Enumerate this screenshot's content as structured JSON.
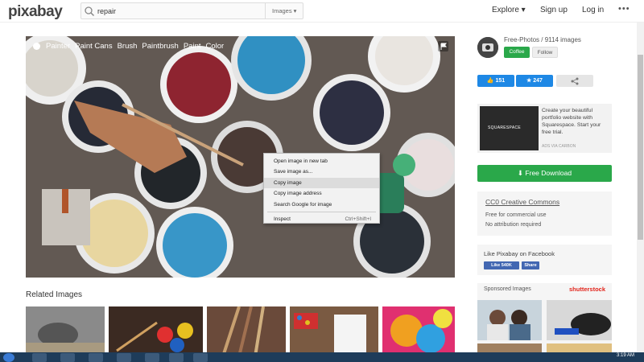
{
  "header": {
    "logo": "pixabay",
    "search_value": "repair",
    "search_type": "Images ▾",
    "nav": [
      "Explore ▾",
      "Sign up",
      "Log in"
    ],
    "more": "•••"
  },
  "photo": {
    "tags": [
      "Painter",
      "Paint Cans",
      "Brush",
      "Paintbrush",
      "Paint",
      "Color"
    ]
  },
  "context_menu": {
    "items": [
      {
        "label": "Open image in new tab",
        "shortcut": ""
      },
      {
        "label": "Save image as...",
        "shortcut": ""
      },
      {
        "label": "Copy image",
        "shortcut": ""
      },
      {
        "label": "Copy image address",
        "shortcut": ""
      },
      {
        "label": "Search Google for image",
        "shortcut": ""
      },
      {
        "label": "Inspect",
        "shortcut": "Ctrl+Shift+I"
      }
    ]
  },
  "related": {
    "title": "Related Images"
  },
  "sidebar": {
    "user_stats": "Free-Photos / 9114 images",
    "coffee_label": "Coffee",
    "follow_label": "Follow",
    "likes": "151",
    "favorites": "247",
    "ad": {
      "brand": "SQUARESPACE",
      "text": "Create your beautiful portfolio website with Squarespace. Start your free trial.",
      "via": "ADS VIA CARBON"
    },
    "download_label": "Free Download",
    "license": {
      "title": "CC0 Creative Commons",
      "lines": [
        "Free for commercial use",
        "No attribution required"
      ]
    },
    "facebook": {
      "title": "Like Pixabay on Facebook",
      "like_label": "Like 540K",
      "share_label": "Share"
    },
    "sponsored": {
      "title": "Sponsored Images",
      "brand": "shutterstock"
    }
  },
  "taskbar": {
    "time": "3:19 AM"
  },
  "colors": {
    "green": "#2aa84a",
    "blue": "#1e88e5",
    "facebook": "#4267b2",
    "shutterstock": "#e2231a"
  }
}
